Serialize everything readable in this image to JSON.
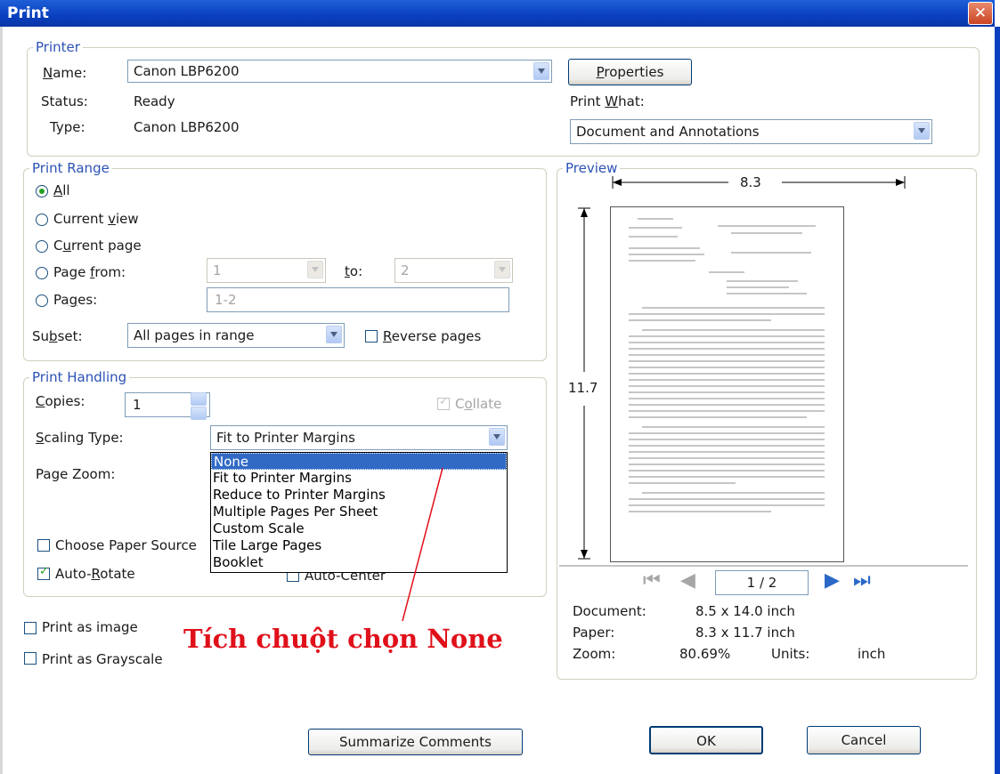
{
  "window": {
    "title": "Print",
    "close": "✕"
  },
  "printer": {
    "legend": "Printer",
    "name_label": "Name:",
    "name_value": "Canon LBP6200",
    "status_label": "Status:",
    "status_value": "Ready",
    "type_label": "Type:",
    "type_value": "Canon LBP6200",
    "properties_button": "Properties",
    "print_what_label": "Print What:",
    "print_what_value": "Document and Annotations"
  },
  "range": {
    "legend": "Print Range",
    "all": "All",
    "current_view": "Current view",
    "current_page": "Current page",
    "page_from": "Page from:",
    "from_value": "1",
    "to_label": "to:",
    "to_value": "2",
    "pages": "Pages:",
    "pages_value": "1-2",
    "subset_label": "Subset:",
    "subset_value": "All pages in range",
    "reverse": "Reverse pages"
  },
  "handling": {
    "legend": "Print Handling",
    "copies_label": "Copies:",
    "copies_value": "1",
    "collate": "Collate",
    "scaling_label": "Scaling Type:",
    "scaling_value": "Fit to Printer Margins",
    "page_zoom_label": "Page Zoom:",
    "paper_source": "Choose Paper Source",
    "auto_rotate": "Auto-Rotate",
    "auto_center": "Auto-Center",
    "options": [
      "None",
      "Fit to Printer Margins",
      "Reduce to Printer Margins",
      "Multiple Pages Per Sheet",
      "Custom Scale",
      "Tile Large Pages",
      "Booklet"
    ]
  },
  "extra": {
    "print_as_image": "Print as image",
    "print_grayscale": "Print as Grayscale"
  },
  "annotation": "Tích chuột chọn None",
  "preview": {
    "legend": "Preview",
    "width": "8.3",
    "height": "11.7",
    "page": "1 / 2",
    "document_label": "Document:",
    "document_value": "8.5 x 14.0 inch",
    "paper_label": "Paper:",
    "paper_value": "8.3 x 11.7 inch",
    "zoom_label": "Zoom:",
    "zoom_value": "80.69%",
    "units_label": "Units:",
    "units_value": "inch"
  },
  "buttons": {
    "summarize": "Summarize Comments",
    "ok": "OK",
    "cancel": "Cancel"
  },
  "colors": {
    "title_bar": "#0a3fbf",
    "group_legend": "#2b52b5",
    "annotation": "#e0101a",
    "selection": "#316ac5"
  }
}
